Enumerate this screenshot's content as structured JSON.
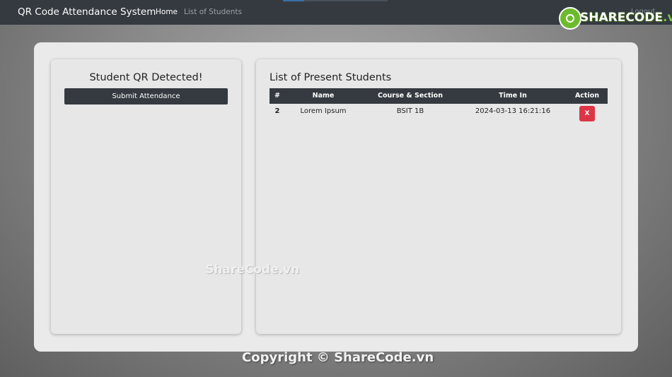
{
  "navbar": {
    "brand": "QR Code Attendance System",
    "links": [
      "Home",
      "List of Students"
    ],
    "logout": "Logout"
  },
  "logo": {
    "text_main": "SHARECODE",
    "text_suffix": ".vn"
  },
  "left_panel": {
    "title": "Student QR Detected!",
    "submit_label": "Submit Attendance"
  },
  "right_panel": {
    "title": "List of Present Students",
    "columns": [
      "#",
      "Name",
      "Course & Section",
      "Time In",
      "Action"
    ],
    "rows": [
      {
        "num": "2",
        "name": "Lorem Ipsum",
        "course": "BSIT 1B",
        "time_in": "2024-03-13 16:21:16",
        "action_label": "X"
      }
    ]
  },
  "watermarks": {
    "middle": "ShareCode.vn",
    "footer": "Copyright © ShareCode.vn"
  },
  "colors": {
    "navbar": "#343a40",
    "delete_button": "#dc3545",
    "logo_green": "#6dbb2d"
  }
}
